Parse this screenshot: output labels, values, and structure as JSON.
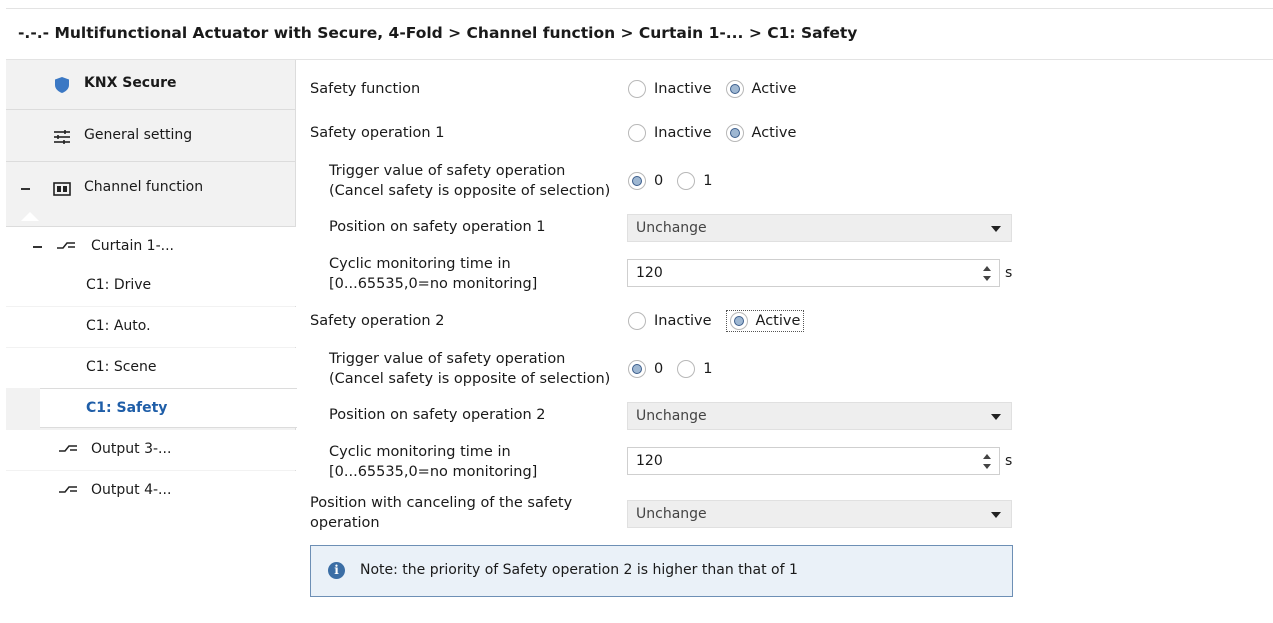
{
  "breadcrumb": "-.-.- Multifunctional Actuator with Secure, 4-Fold > Channel function > Curtain 1-... > C1: Safety",
  "sidebar": {
    "knx_secure": "KNX Secure",
    "general_setting": "General setting",
    "channel_function": "Channel function",
    "curtain": "Curtain 1-...",
    "sub_items": [
      "C1: Drive",
      "C1: Auto.",
      "C1: Scene",
      "C1: Safety"
    ],
    "output3": "Output 3-...",
    "output4": "Output 4-...",
    "selected": "C1: Safety"
  },
  "form": {
    "safety_function": {
      "label": "Safety function",
      "opt1": "Inactive",
      "opt2": "Active",
      "selected": "Active"
    },
    "safety_op1": {
      "label": "Safety operation 1",
      "opt1": "Inactive",
      "opt2": "Active",
      "selected": "Active"
    },
    "trigger1": {
      "label_line1": "Trigger value of safety operation",
      "label_line2": "(Cancel safety is opposite of  selection)",
      "opt1": "0",
      "opt2": "1",
      "selected": "0"
    },
    "position1": {
      "label": "Position on safety operation 1",
      "value": "Unchange"
    },
    "cyclic1": {
      "label_line1": "Cyclic monitoring time in",
      "label_line2": "[0...65535,0=no monitoring]",
      "value": "120",
      "unit": "s"
    },
    "safety_op2": {
      "label": "Safety operation 2",
      "opt1": "Inactive",
      "opt2": "Active",
      "selected": "Active"
    },
    "trigger2": {
      "label_line1": "Trigger value of safety operation",
      "label_line2": "(Cancel safety is opposite of  selection)",
      "opt1": "0",
      "opt2": "1",
      "selected": "0"
    },
    "position2": {
      "label": "Position on safety operation 2",
      "value": "Unchange"
    },
    "cyclic2": {
      "label_line1": "Cyclic monitoring time in",
      "label_line2": "[0...65535,0=no monitoring]",
      "value": "120",
      "unit": "s"
    },
    "cancel_position": {
      "label_line1": "Position with canceling of the safety",
      "label_line2": "operation",
      "value": "Unchange"
    }
  },
  "note": {
    "icon": "info-icon",
    "text": "Note: the priority of Safety operation 2 is higher than that of 1"
  },
  "colors": {
    "accent": "#1f5ea8",
    "shield": "#3b78c4",
    "note_border": "#6d8fb5",
    "note_bg": "#eaf1f8"
  }
}
